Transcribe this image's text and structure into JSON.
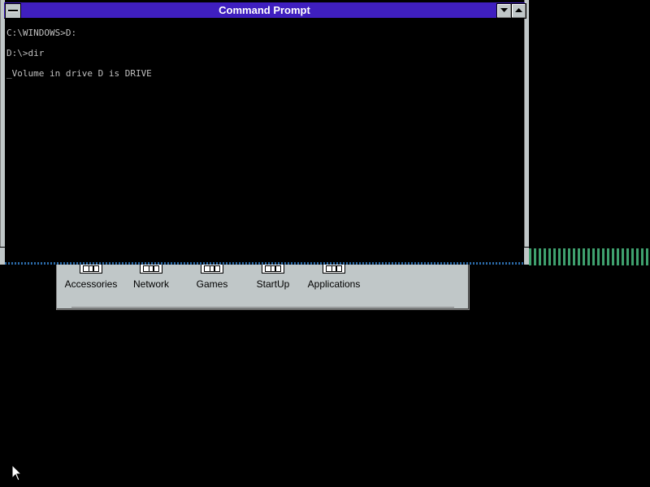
{
  "command_prompt": {
    "title": "Command Prompt",
    "lines": [
      "C:\\WINDOWS>D:",
      "D:\\>dir",
      "_Volume in drive D is DRIVE"
    ],
    "colors": {
      "titlebar": "#3f1fbf",
      "background": "#000000",
      "text": "#c0c0c0"
    },
    "buttons": {
      "minimize_icon": "down-arrow-icon",
      "maximize_icon": "up-arrow-icon"
    }
  },
  "program_group": {
    "icons": [
      {
        "label": "Accessories",
        "icon": "program-group-icon"
      },
      {
        "label": "Network",
        "icon": "program-group-icon"
      },
      {
        "label": "Games",
        "icon": "program-group-icon"
      },
      {
        "label": "StartUp",
        "icon": "program-group-icon"
      },
      {
        "label": "Applications",
        "icon": "program-group-icon"
      }
    ]
  }
}
